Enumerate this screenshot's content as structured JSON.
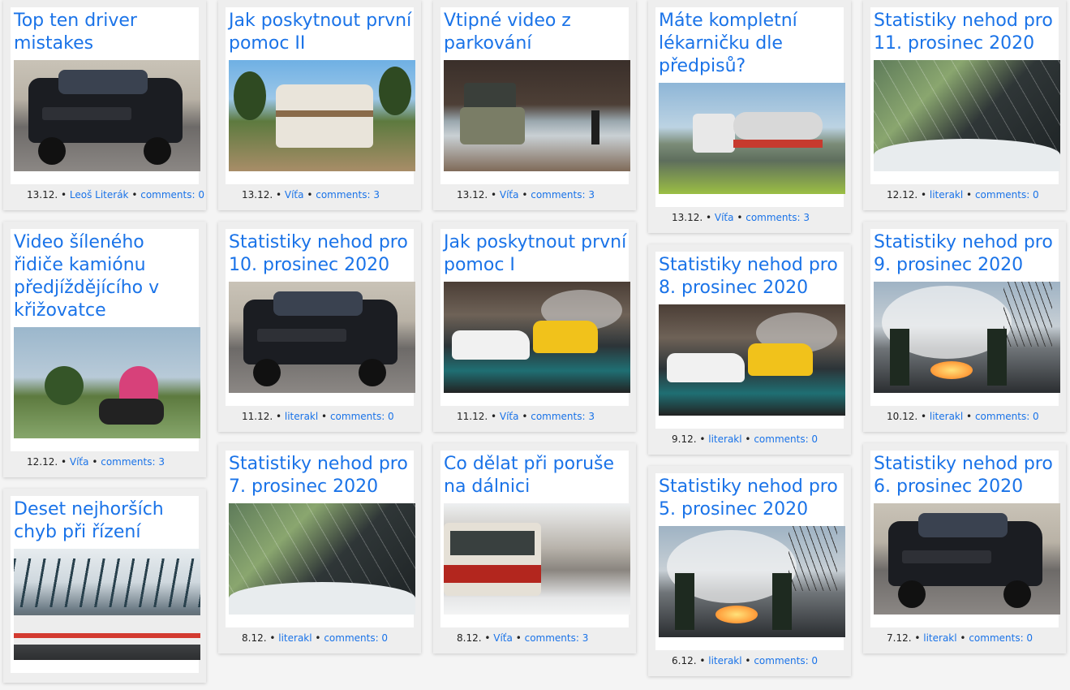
{
  "columns": [
    {
      "cards": [
        {
          "title": "Top ten driver mistakes",
          "image": "car-crash-photo",
          "date": "13.12.",
          "author": "Leoš Literák",
          "comments": "comments: 0"
        },
        {
          "title": "Video šíleného řidiče kamiónu předjíždějícího v křižovatce",
          "image": "motorbike-photo",
          "date": "12.12.",
          "author": "Víťa",
          "comments": "comments: 3"
        },
        {
          "title": "Deset nejhorších chyb při řízení",
          "image": "train-station-photo"
        }
      ]
    },
    {
      "cards": [
        {
          "title": "Jak poskytnout první pomoc II",
          "image": "rv-camper-photo",
          "date": "13.12.",
          "author": "Víťa",
          "comments": "comments: 3"
        },
        {
          "title": "Statistiky nehod pro 10. prosinec 2020",
          "image": "car-crash-photo",
          "date": "11.12.",
          "author": "literakl",
          "comments": "comments: 0"
        },
        {
          "title": "Statistiky nehod pro 7. prosinec 2020",
          "image": "broken-windshield-photo",
          "date": "8.12.",
          "author": "literakl",
          "comments": "comments: 0"
        }
      ]
    },
    {
      "cards": [
        {
          "title": "Vtipné video z parkování",
          "image": "lake-camper-photo",
          "date": "13.12.",
          "author": "Víťa",
          "comments": "comments: 3"
        },
        {
          "title": "Jak poskytnout první pomoc I",
          "image": "rally-cars-photo",
          "date": "11.12.",
          "author": "Víťa",
          "comments": "comments: 3"
        },
        {
          "title": "Co dělat při poruše na dálnici",
          "image": "tram-snow-photo",
          "date": "8.12.",
          "author": "Víťa",
          "comments": "comments: 3"
        }
      ]
    },
    {
      "cards": [
        {
          "title": "Máte kompletní lékarničku dle předpisů?",
          "image": "tanker-truck-photo",
          "date": "13.12.",
          "author": "Víťa",
          "comments": "comments: 3"
        },
        {
          "title": "Statistiky nehod pro 8. prosinec 2020",
          "image": "rally-cars-photo",
          "date": "9.12.",
          "author": "literakl",
          "comments": "comments: 0"
        },
        {
          "title": "Statistiky nehod pro 5. prosinec 2020",
          "image": "firefighters-photo",
          "date": "6.12.",
          "author": "literakl",
          "comments": "comments: 0"
        }
      ]
    },
    {
      "cards": [
        {
          "title": "Statistiky nehod pro 11. prosinec 2020",
          "image": "broken-windshield-photo",
          "date": "12.12.",
          "author": "literakl",
          "comments": "comments: 0"
        },
        {
          "title": "Statistiky nehod pro 9. prosinec 2020",
          "image": "firefighters-photo",
          "date": "10.12.",
          "author": "literakl",
          "comments": "comments: 0"
        },
        {
          "title": "Statistiky nehod pro 6. prosinec 2020",
          "image": "car-crash-photo",
          "date": "7.12.",
          "author": "literakl",
          "comments": "comments: 0"
        }
      ]
    }
  ],
  "separator": " • ",
  "colors": {
    "link": "#1a73e8",
    "card": "#eeeeee",
    "page": "#f4f4f4"
  }
}
